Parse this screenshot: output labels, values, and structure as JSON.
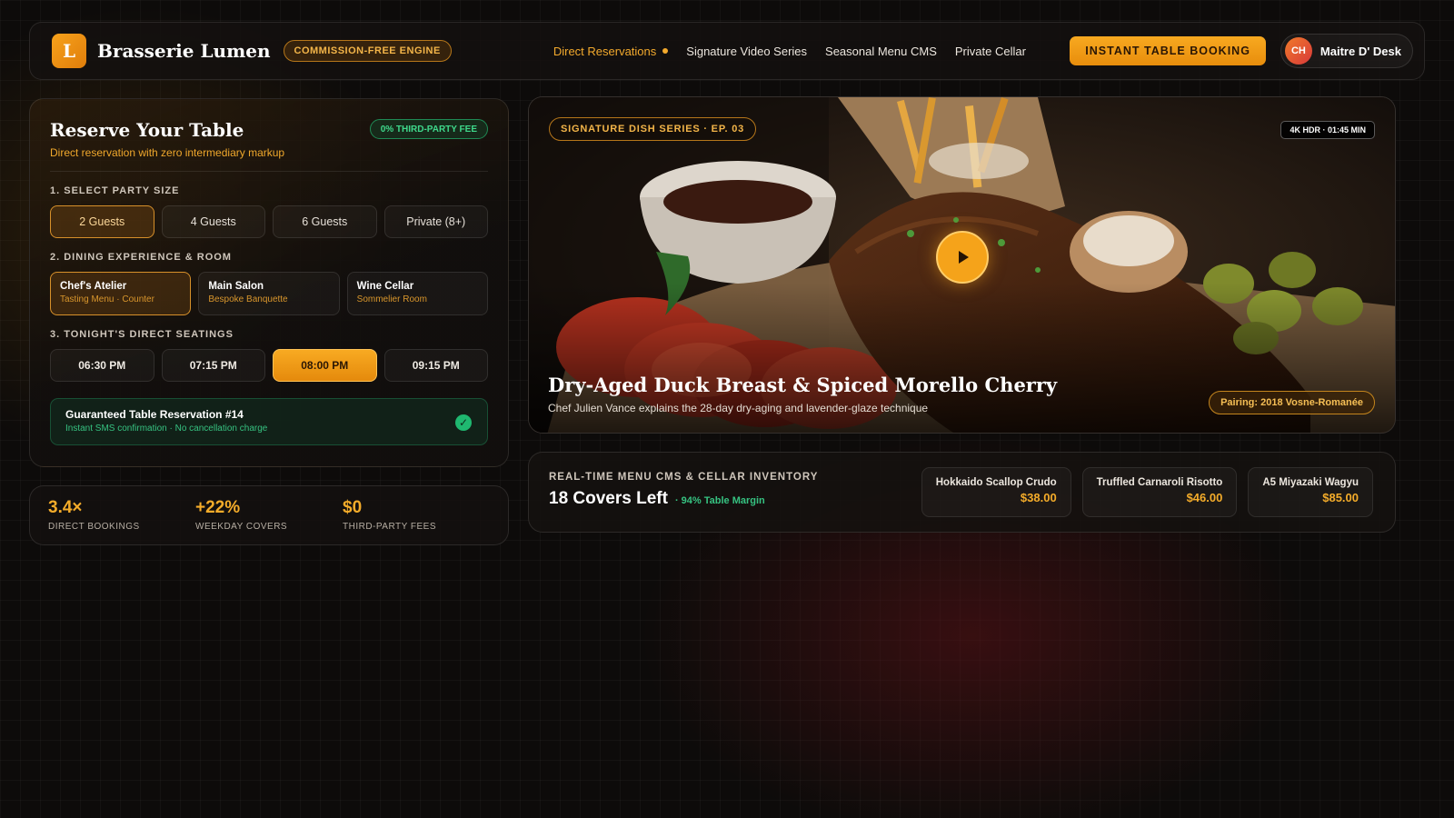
{
  "navbar": {
    "logo_letter": "L",
    "brand": "Brasserie Lumen",
    "engine_badge": "COMMISSION-FREE ENGINE",
    "links": [
      {
        "label": "Direct Reservations",
        "active": true
      },
      {
        "label": "Signature Video Series",
        "active": false
      },
      {
        "label": "Seasonal Menu CMS",
        "active": false
      },
      {
        "label": "Private Cellar",
        "active": false
      }
    ],
    "cta": "INSTANT TABLE BOOKING",
    "user": {
      "initials": "CH",
      "name": "Maitre D' Desk"
    }
  },
  "reservation": {
    "title": "Reserve Your Table",
    "subtitle": "Direct reservation with zero intermediary markup",
    "fee_badge": "0% THIRD-PARTY FEE",
    "party_label": "1. SELECT PARTY SIZE",
    "party_options": [
      "2 Guests",
      "4 Guests",
      "6 Guests",
      "Private (8+)"
    ],
    "party_selected": "2 Guests",
    "room_label": "2. DINING EXPERIENCE & ROOM",
    "rooms": [
      {
        "name": "Chef's Atelier",
        "desc": "Tasting Menu · Counter"
      },
      {
        "name": "Main Salon",
        "desc": "Bespoke Banquette"
      },
      {
        "name": "Wine Cellar",
        "desc": "Sommelier Room"
      }
    ],
    "room_selected": "Chef's Atelier",
    "seating_label": "3. TONIGHT'S DIRECT SEATINGS",
    "times": [
      "06:30 PM",
      "07:15 PM",
      "08:00 PM",
      "09:15 PM"
    ],
    "time_selected": "08:00 PM",
    "confirm_title": "Guaranteed Table Reservation #14",
    "confirm_sub": "Instant SMS confirmation · No cancellation charge",
    "confirm_icon": "check-circle-icon"
  },
  "stats": [
    {
      "value": "3.4×",
      "label": "DIRECT BOOKINGS"
    },
    {
      "value": "+22%",
      "label": "WEEKDAY COVERS"
    },
    {
      "value": "$0",
      "label": "THIRD-PARTY FEES"
    }
  ],
  "video": {
    "episode_badge": "SIGNATURE DISH SERIES · EP. 03",
    "resolution_badge": "4K HDR · 01:45 MIN",
    "title": "Dry-Aged Duck Breast & Spiced Morello Cherry",
    "subtitle": "Chef Julien Vance explains the 28-day dry-aging and lavender-glaze technique",
    "pairing": "Pairing: 2018 Vosne-Romanée",
    "play_icon": "play-icon"
  },
  "inventory": {
    "label": "REAL-TIME MENU CMS & CELLAR INVENTORY",
    "covers": "18 Covers Left",
    "margin": "· 94% Table Margin",
    "dishes": [
      {
        "name": "Hokkaido Scallop Crudo",
        "price": "$38.00"
      },
      {
        "name": "Truffled Carnaroli Risotto",
        "price": "$46.00"
      },
      {
        "name": "A5 Miyazaki Wagyu",
        "price": "$85.00"
      }
    ]
  },
  "colors": {
    "accent": "#f5a31a",
    "success": "#36c281",
    "background": "#0d0b0a"
  }
}
